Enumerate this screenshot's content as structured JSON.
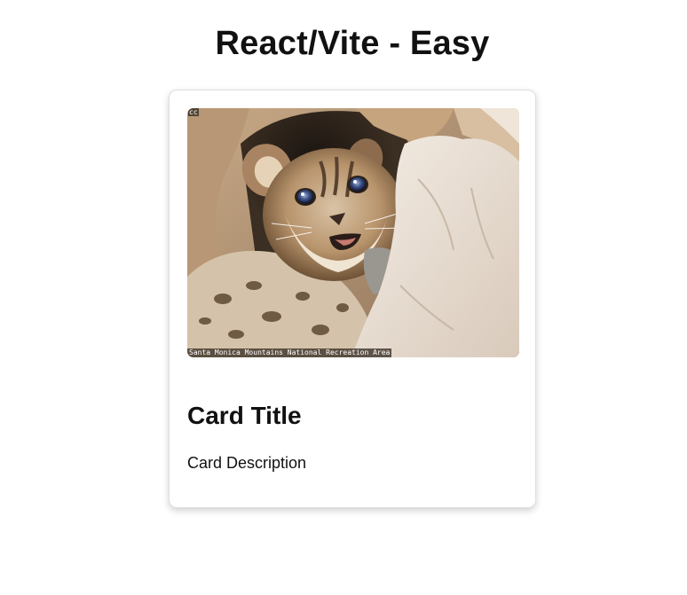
{
  "page": {
    "title": "React/Vite - Easy"
  },
  "card": {
    "image": {
      "subject": "mountain lion kitten among rocks",
      "corner_mark": "cc",
      "credit": "Santa Monica Mountains National Recreation Area"
    },
    "title": "Card Title",
    "description": "Card Description"
  }
}
